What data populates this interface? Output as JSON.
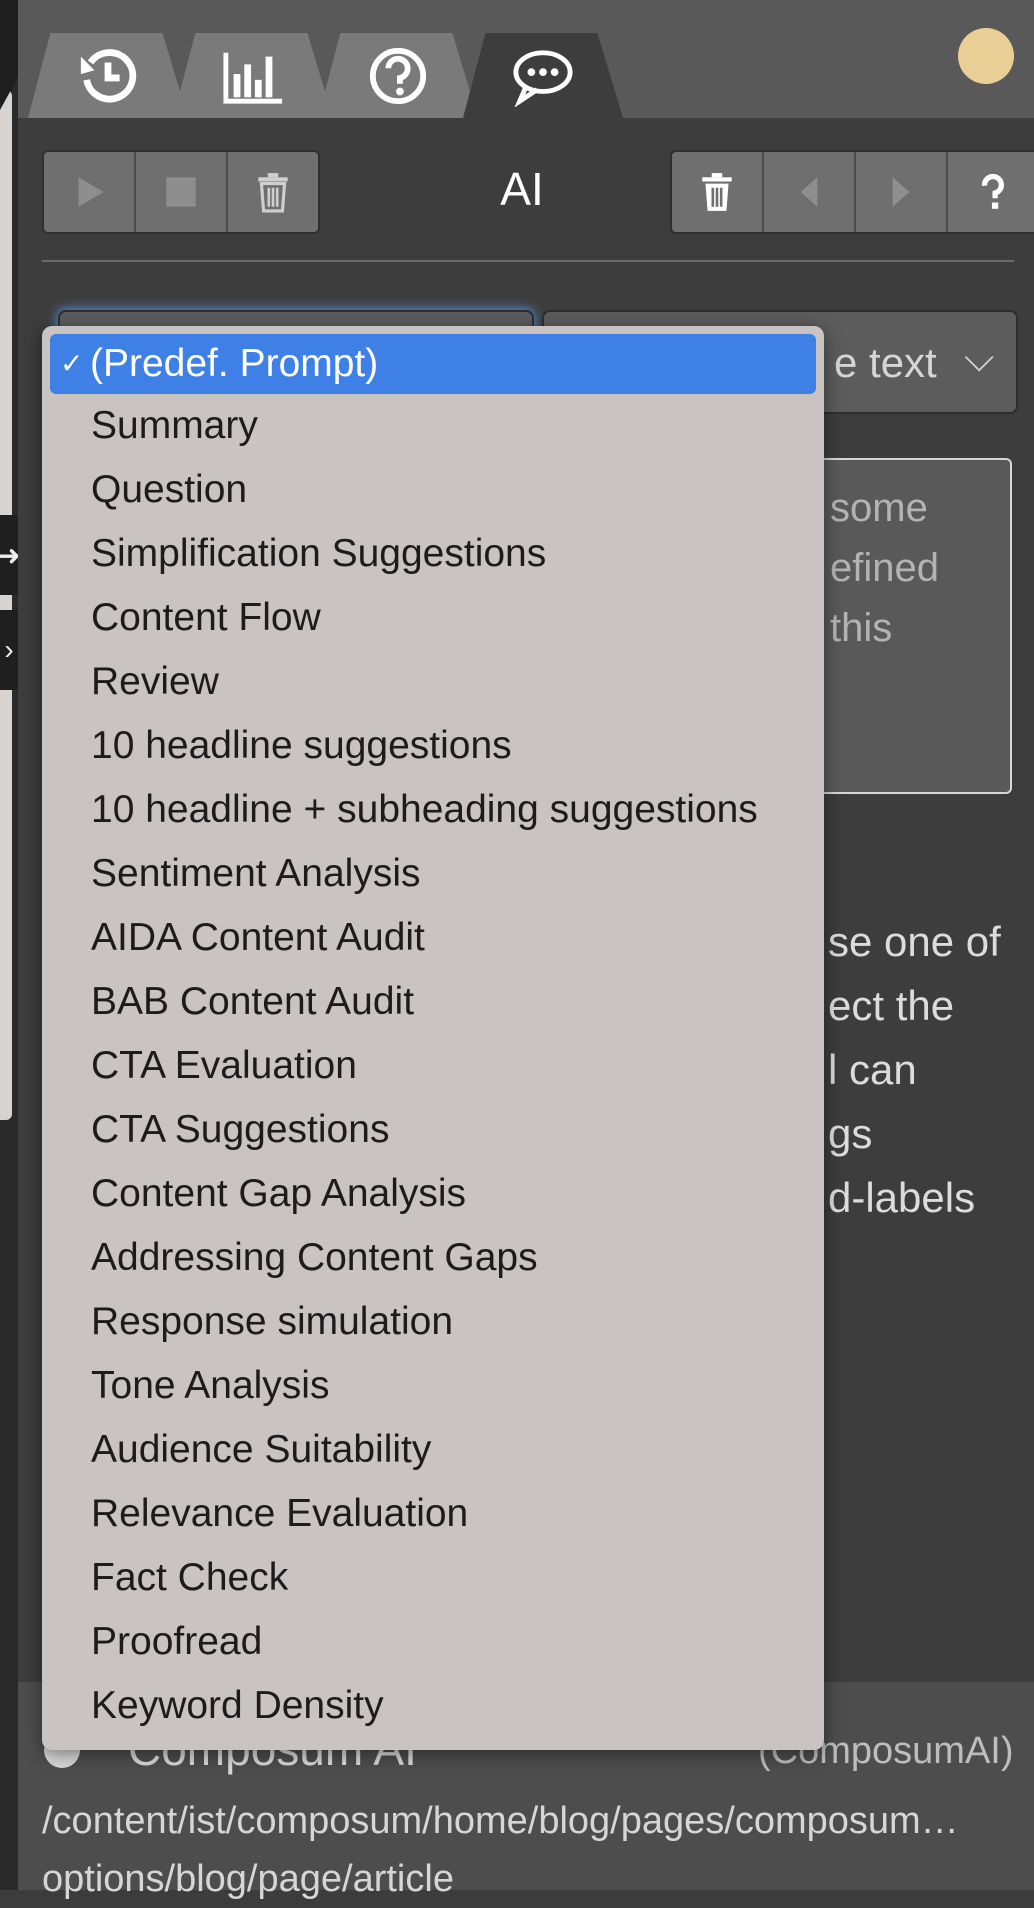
{
  "tabs": [
    {
      "name": "history",
      "icon": "history-icon"
    },
    {
      "name": "statistics",
      "icon": "bar-chart-icon"
    },
    {
      "name": "help",
      "icon": "question-circle-icon"
    },
    {
      "name": "ai-chat",
      "icon": "chat-bubble-icon",
      "active": true
    }
  ],
  "toolbar": {
    "title": "AI",
    "left_buttons": [
      "play-icon",
      "stop-icon",
      "trash-icon"
    ],
    "right_buttons": [
      "trash-icon",
      "prev-icon",
      "next-icon",
      "question-icon"
    ]
  },
  "content_select": {
    "visible_value": "e text"
  },
  "prompt_textarea": {
    "placeholder_lines": [
      "some",
      "efined",
      "this"
    ]
  },
  "help_text_lines": [
    "se one of",
    "ect the",
    "l can",
    "gs",
    "d-labels"
  ],
  "dropdown": {
    "selected": "(Predef. Prompt)",
    "items": [
      "(Predef. Prompt)",
      "Summary",
      "Question",
      "Simplification Suggestions",
      "Content Flow",
      "Review",
      "10 headline suggestions",
      "10 headline + subheading suggestions",
      "Sentiment Analysis",
      "AIDA Content Audit",
      "BAB Content Audit",
      "CTA Evaluation",
      "CTA Suggestions",
      "Content Gap Analysis",
      "Addressing Content Gaps",
      "Response simulation",
      "Tone Analysis",
      "Audience Suitability",
      "Relevance Evaluation",
      "Fact Check",
      "Proofread",
      "Keyword Density"
    ]
  },
  "footer": {
    "title": "Composum AI",
    "namespace": "(ComposumAI)",
    "path_line1": "/content/ist/composum/home/blog/pages/composum…",
    "path_line2": "options/blog/page/article"
  },
  "colors": {
    "accent": "#3f80e6",
    "status_dot": "#e9cf95",
    "panel": "#3d3d3d"
  }
}
